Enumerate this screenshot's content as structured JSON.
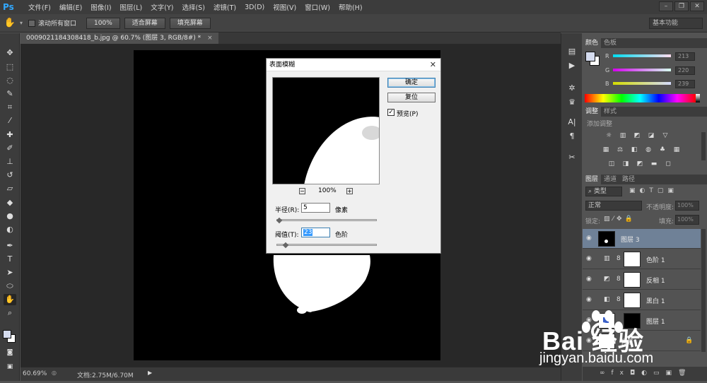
{
  "app": {
    "logo": "Ps",
    "menus": [
      "文件(F)",
      "编辑(E)",
      "图像(I)",
      "图层(L)",
      "文字(Y)",
      "选择(S)",
      "滤镜(T)",
      "3D(D)",
      "视图(V)",
      "窗口(W)",
      "帮助(H)"
    ]
  },
  "options": {
    "scroll_all_label": "滚动所有窗口",
    "zoom_100": "100%",
    "fit_screen": "适合屏幕",
    "fill_screen": "填充屏幕",
    "workspace": "基本功能"
  },
  "document": {
    "tab_label": "0009021184308418_b.jpg @ 60.7% (图层 3, RGB/8#) *",
    "zoom": "60.69%",
    "doc_size": "文档:2.75M/6.70M"
  },
  "dialog": {
    "title": "表面模糊",
    "ok": "确定",
    "reset": "复位",
    "preview_label": "预览(P)",
    "preview_checked": true,
    "preview_zoom": "100%",
    "radius_label": "半径(R):",
    "radius_value": "5",
    "radius_unit": "像素",
    "radius_fraction": 0.03,
    "threshold_label": "阈值(T):",
    "threshold_value": "23",
    "threshold_unit": "色阶",
    "threshold_fraction": 0.09
  },
  "color_panel": {
    "tabs": [
      "颜色",
      "色板"
    ],
    "r": 213,
    "g": 220,
    "b": 239,
    "r_label": "R",
    "g_label": "G",
    "b_label": "B"
  },
  "adjust_panel": {
    "tabs": [
      "调整",
      "样式"
    ],
    "add_label": "添加调整"
  },
  "layers_panel": {
    "tabs": [
      "图层",
      "通道",
      "路径"
    ],
    "filter_kind": "类型",
    "blend_mode": "正常",
    "opacity_label": "不透明度:",
    "opacity": "100%",
    "lock_label": "锁定:",
    "fill_label": "填充:",
    "fill": "100%",
    "layers": [
      {
        "name": "图层 3",
        "selected": true
      },
      {
        "name": "色阶 1",
        "selected": false
      },
      {
        "name": "反相 1",
        "selected": false
      },
      {
        "name": "黑白 1",
        "selected": false
      },
      {
        "name": "图层 1",
        "selected": false
      },
      {
        "name": "背景",
        "selected": false
      }
    ]
  },
  "watermark": {
    "brand": "Bai 经验",
    "url": "jingyan.baidu.com"
  },
  "colors": {
    "accent": "#31a8ff",
    "selected_layer": "#6f8197",
    "fg_swatch": "#d5dcef"
  }
}
